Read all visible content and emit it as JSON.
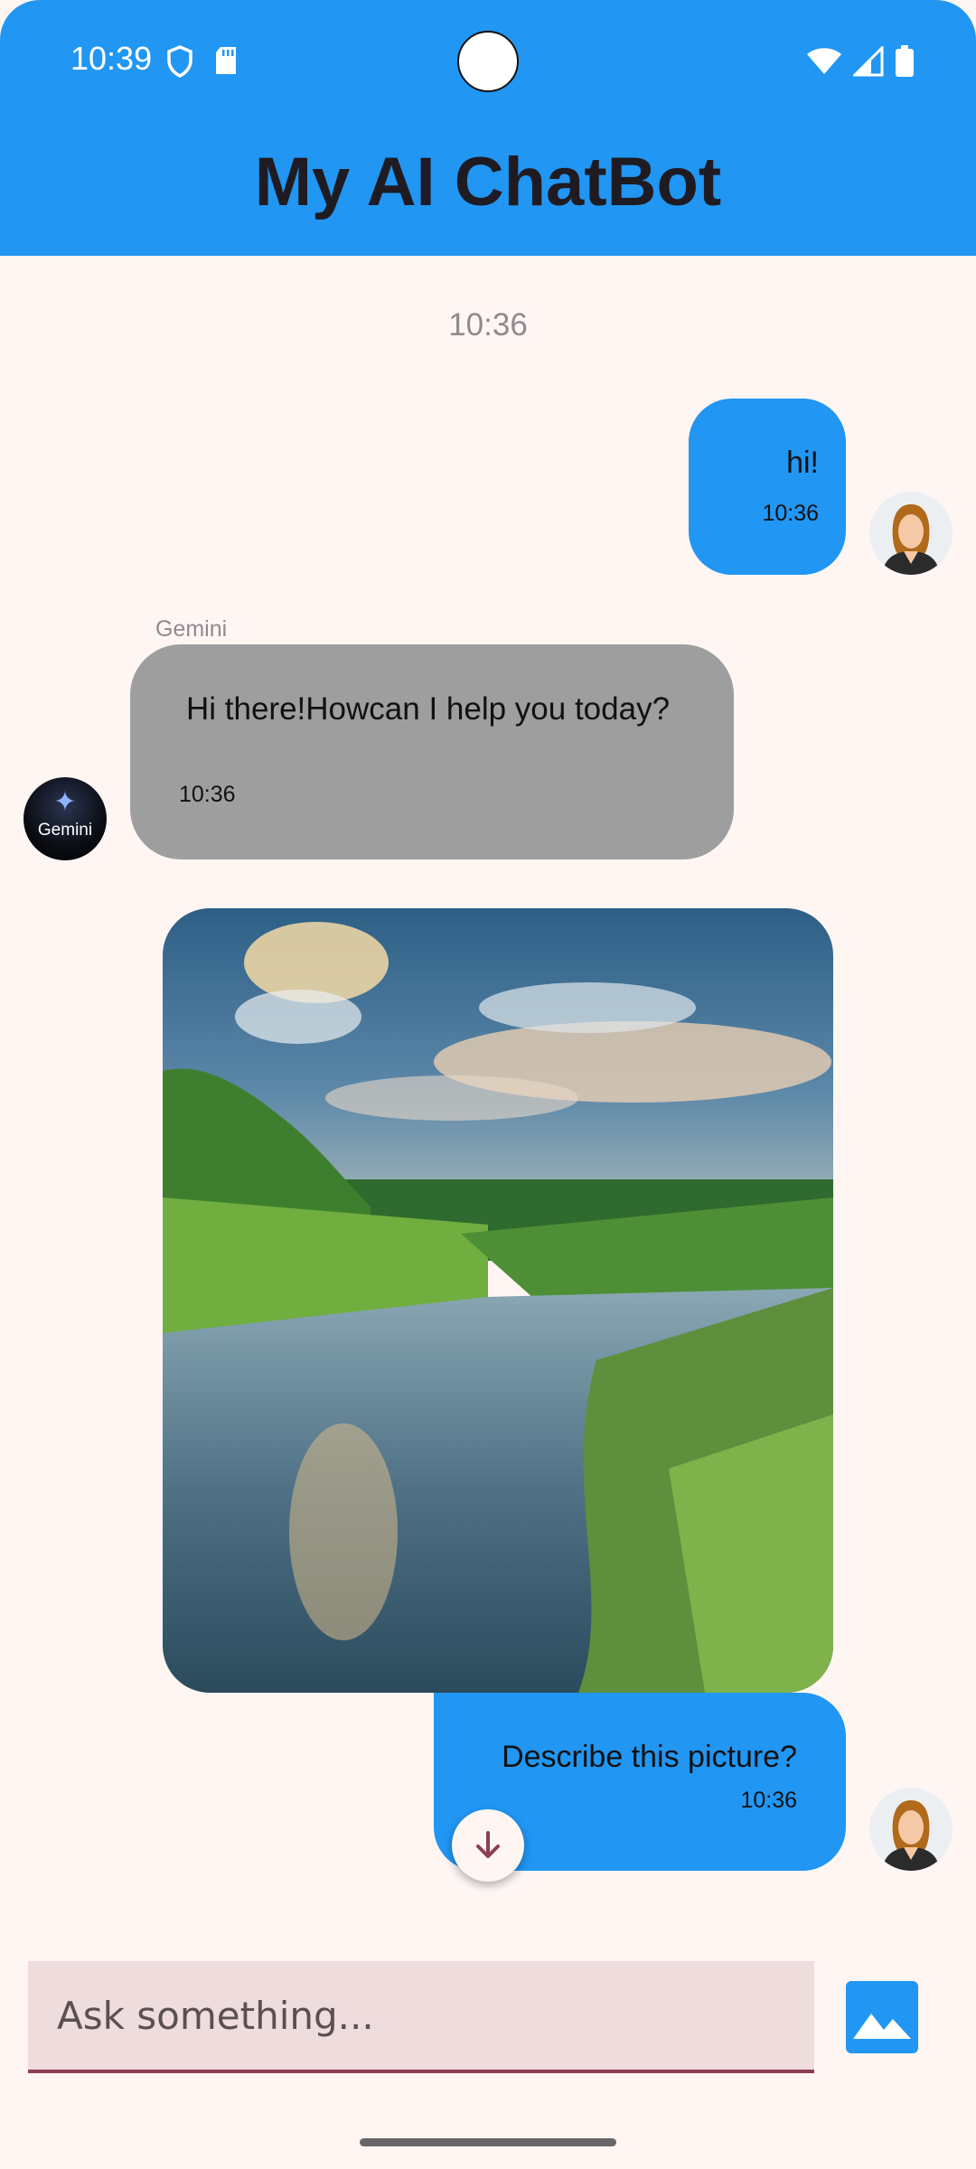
{
  "status_bar": {
    "time": "10:39"
  },
  "header": {
    "title": "My AI ChatBot",
    "color": "#2196f3"
  },
  "chat": {
    "date_label": "10:36",
    "messages": [
      {
        "sender": "user",
        "text": "hi!",
        "time": "10:36"
      },
      {
        "sender": "bot",
        "sender_name": "Gemini",
        "text": "Hi there!Howcan I help you today?",
        "time": "10:36"
      },
      {
        "sender": "user",
        "type": "image",
        "description_icon": "landscape-photo"
      },
      {
        "sender": "user",
        "text": "Describe this picture?",
        "time": "10:36"
      }
    ],
    "bot_avatar_label": "Gemini"
  },
  "input": {
    "placeholder": "Ask something..."
  },
  "colors": {
    "user_bubble": "#2196f3",
    "bot_bubble": "#9e9e9e",
    "accent": "#8b3f56",
    "background": "#fff6f4"
  }
}
